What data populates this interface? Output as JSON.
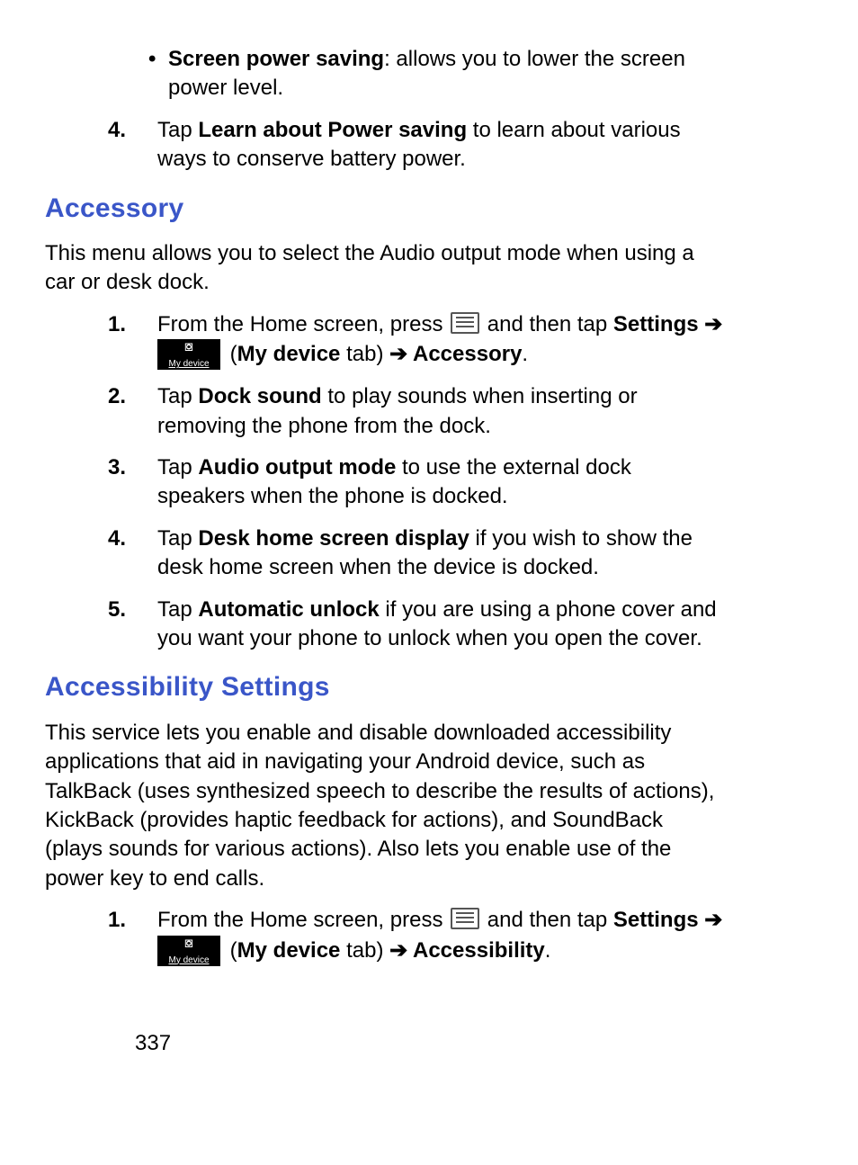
{
  "bullet1": {
    "term": "Screen power saving",
    "desc": ": allows you to lower the screen power level."
  },
  "step4_top": {
    "num": "4.",
    "pre": "Tap ",
    "bold": "Learn about Power saving",
    "post": " to learn about various ways to conserve battery power."
  },
  "accessory": {
    "heading": "Accessory",
    "intro": "This menu allows you to select the Audio output mode when using a car or desk dock.",
    "s1": {
      "num": "1.",
      "pre": "From the Home screen, press ",
      "mid": " and then tap ",
      "settings": "Settings",
      "arrow1": " ➔",
      "device_label": "My device",
      "paren_open": " (",
      "mydevice_bold": "My device",
      "tab_text": " tab) ",
      "arrow2": "➔ ",
      "target": "Accessory",
      "period": "."
    },
    "s2": {
      "num": "2.",
      "pre": "Tap ",
      "bold": "Dock sound",
      "post": " to play sounds when inserting or removing the phone from the dock."
    },
    "s3": {
      "num": "3.",
      "pre": "Tap ",
      "bold": "Audio output mode",
      "post": " to use the external dock speakers when the phone is docked."
    },
    "s4": {
      "num": "4.",
      "pre": "Tap ",
      "bold": "Desk home screen display",
      "post": " if you wish to show the desk home screen when the device is docked."
    },
    "s5": {
      "num": "5.",
      "pre": "Tap ",
      "bold": "Automatic unlock",
      "post": " if you are using a phone cover and you want your phone to unlock when you open the cover."
    }
  },
  "accessibility": {
    "heading": "Accessibility Settings",
    "intro": "This service lets you enable and disable downloaded accessibility applications that aid in navigating your Android device, such as TalkBack (uses synthesized speech to describe the results of actions), KickBack (provides haptic feedback for actions), and SoundBack (plays sounds for various actions). Also lets you enable use of the power key to end calls.",
    "s1": {
      "num": "1.",
      "pre": "From the Home screen, press ",
      "mid": " and then tap ",
      "settings": "Settings",
      "arrow1": " ➔",
      "device_label": "My device",
      "paren_open": " (",
      "mydevice_bold": "My device",
      "tab_text": " tab) ",
      "arrow2": "➔ ",
      "target": "Accessibility",
      "period": "."
    }
  },
  "page_number": "337"
}
